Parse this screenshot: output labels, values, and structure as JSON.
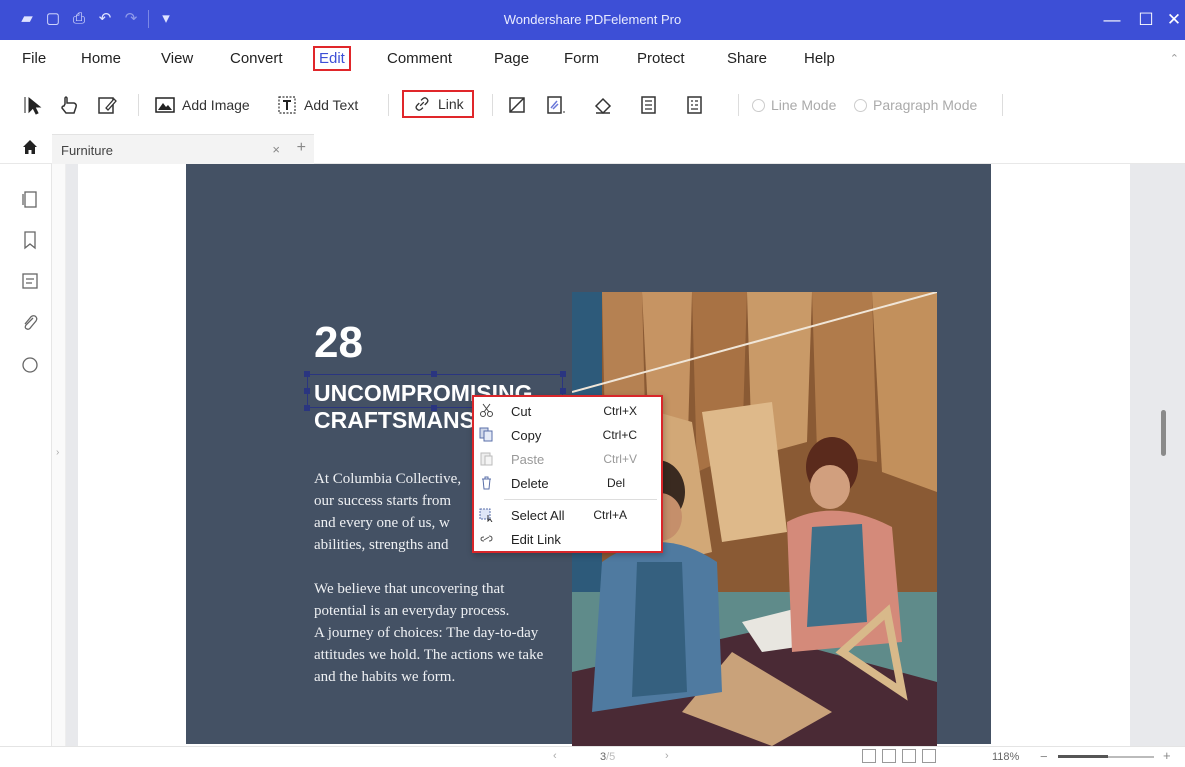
{
  "app": {
    "title": "Wondershare PDFelement Pro",
    "accent_color": "#3d4fd6",
    "highlight_color": "#e0262a"
  },
  "menu": {
    "items": [
      "File",
      "Home",
      "View",
      "Convert",
      "Edit",
      "Comment",
      "Page",
      "Form",
      "Protect",
      "Share",
      "Help"
    ],
    "active": "Edit"
  },
  "toolbar": {
    "add_image": "Add Image",
    "add_text": "Add Text",
    "link": "Link",
    "line_mode": "Line Mode",
    "paragraph_mode": "Paragraph Mode"
  },
  "tabs": [
    {
      "label": "Furniture",
      "close": "×"
    }
  ],
  "tab_add": "+",
  "document": {
    "number": "28",
    "headline_line1": "UNCOMPROMISING",
    "headline_line2": "CRAFTSMANSHIP",
    "para1": [
      "At Columbia Collective,",
      "our success starts from",
      "and every one of us, w",
      "abilities, strengths and"
    ],
    "para2": [
      "We believe that uncovering that",
      "potential is an everyday process.",
      "A journey of choices: The day-to-day",
      "attitudes we hold. The actions we take",
      "and the habits we form."
    ]
  },
  "context_menu": {
    "items": [
      {
        "label": "Cut",
        "shortcut": "Ctrl+X",
        "icon": "scissors-icon",
        "disabled": false
      },
      {
        "label": "Copy",
        "shortcut": "Ctrl+C",
        "icon": "copy-icon",
        "disabled": false
      },
      {
        "label": "Paste",
        "shortcut": "Ctrl+V",
        "icon": "paste-icon",
        "disabled": true
      },
      {
        "label": "Delete",
        "shortcut": "Del",
        "icon": "trash-icon",
        "disabled": false
      },
      {
        "label": "Select All",
        "shortcut": "Ctrl+A",
        "icon": "select-all-icon",
        "disabled": false
      },
      {
        "label": "Edit Link",
        "shortcut": "",
        "icon": "link-icon",
        "disabled": false
      }
    ]
  },
  "status": {
    "page": "3",
    "page_suffix": "/5",
    "zoom": "118%",
    "zoom_minus": "−",
    "zoom_plus": "+"
  }
}
